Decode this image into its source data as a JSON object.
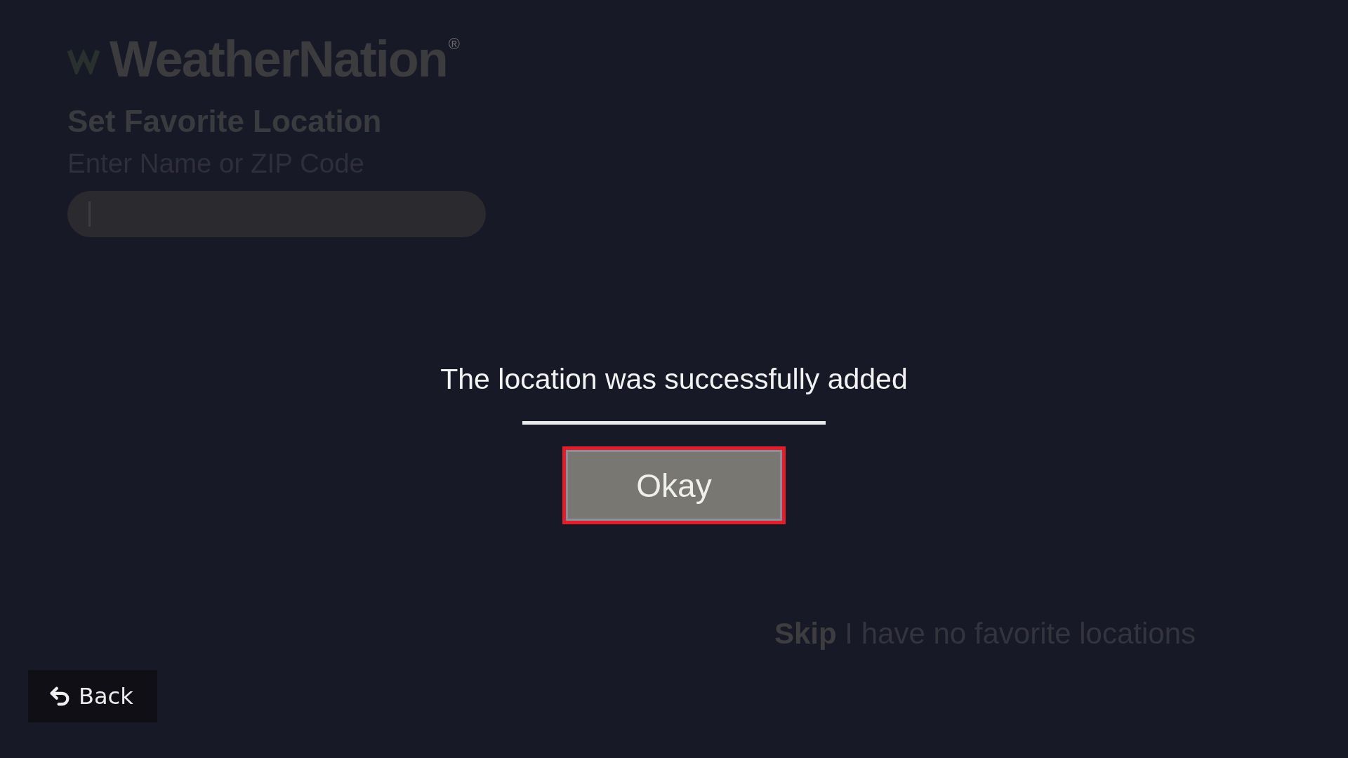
{
  "logo": {
    "name": "WeatherNation",
    "mark": "®"
  },
  "title": "Set Favorite Location",
  "search": {
    "prompt": "Enter Name or ZIP Code",
    "focused": true
  },
  "dialog": {
    "message": "The location was successfully added",
    "buttons": [
      {
        "label": "Okay",
        "selected": true
      }
    ]
  },
  "skip": "**Skip** I have no favorite locations",
  "back_button": {
    "label": "Back"
  }
}
